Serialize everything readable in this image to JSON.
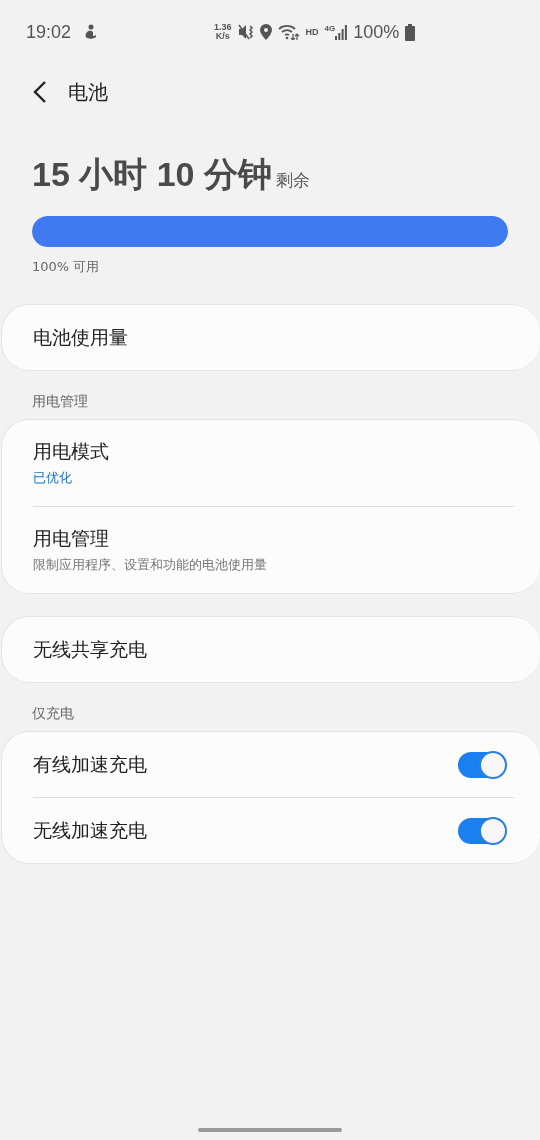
{
  "status_bar": {
    "time": "19:02",
    "net_speed_value": "1.36",
    "net_speed_unit": "K/s",
    "hd": "HD",
    "network": "4G",
    "battery": "100%"
  },
  "header": {
    "title": "电池"
  },
  "summary": {
    "remaining_big": "15 小时 10 分钟",
    "remaining_suffix": "剩余",
    "level": 1.0,
    "available": "100% 可用"
  },
  "sections": [
    {
      "cards": [
        {
          "items": [
            {
              "kind": "link",
              "title": "电池使用量"
            }
          ]
        }
      ]
    },
    {
      "label": "用电管理",
      "cards": [
        {
          "items": [
            {
              "kind": "two_line",
              "title": "用电模式",
              "subtitle": "已优化",
              "subtitle_highlighted": true
            },
            {
              "kind": "two_line",
              "title": "用电管理",
              "subtitle": "限制应用程序、设置和功能的电池使用量",
              "subtitle_highlighted": false
            }
          ]
        },
        {
          "items": [
            {
              "kind": "link",
              "title": "无线共享充电"
            }
          ]
        }
      ]
    },
    {
      "label": "仅充电",
      "cards": [
        {
          "items": [
            {
              "kind": "toggle",
              "title": "有线加速充电",
              "on": true
            },
            {
              "kind": "toggle",
              "title": "无线加速充电",
              "on": true
            }
          ]
        }
      ]
    }
  ]
}
